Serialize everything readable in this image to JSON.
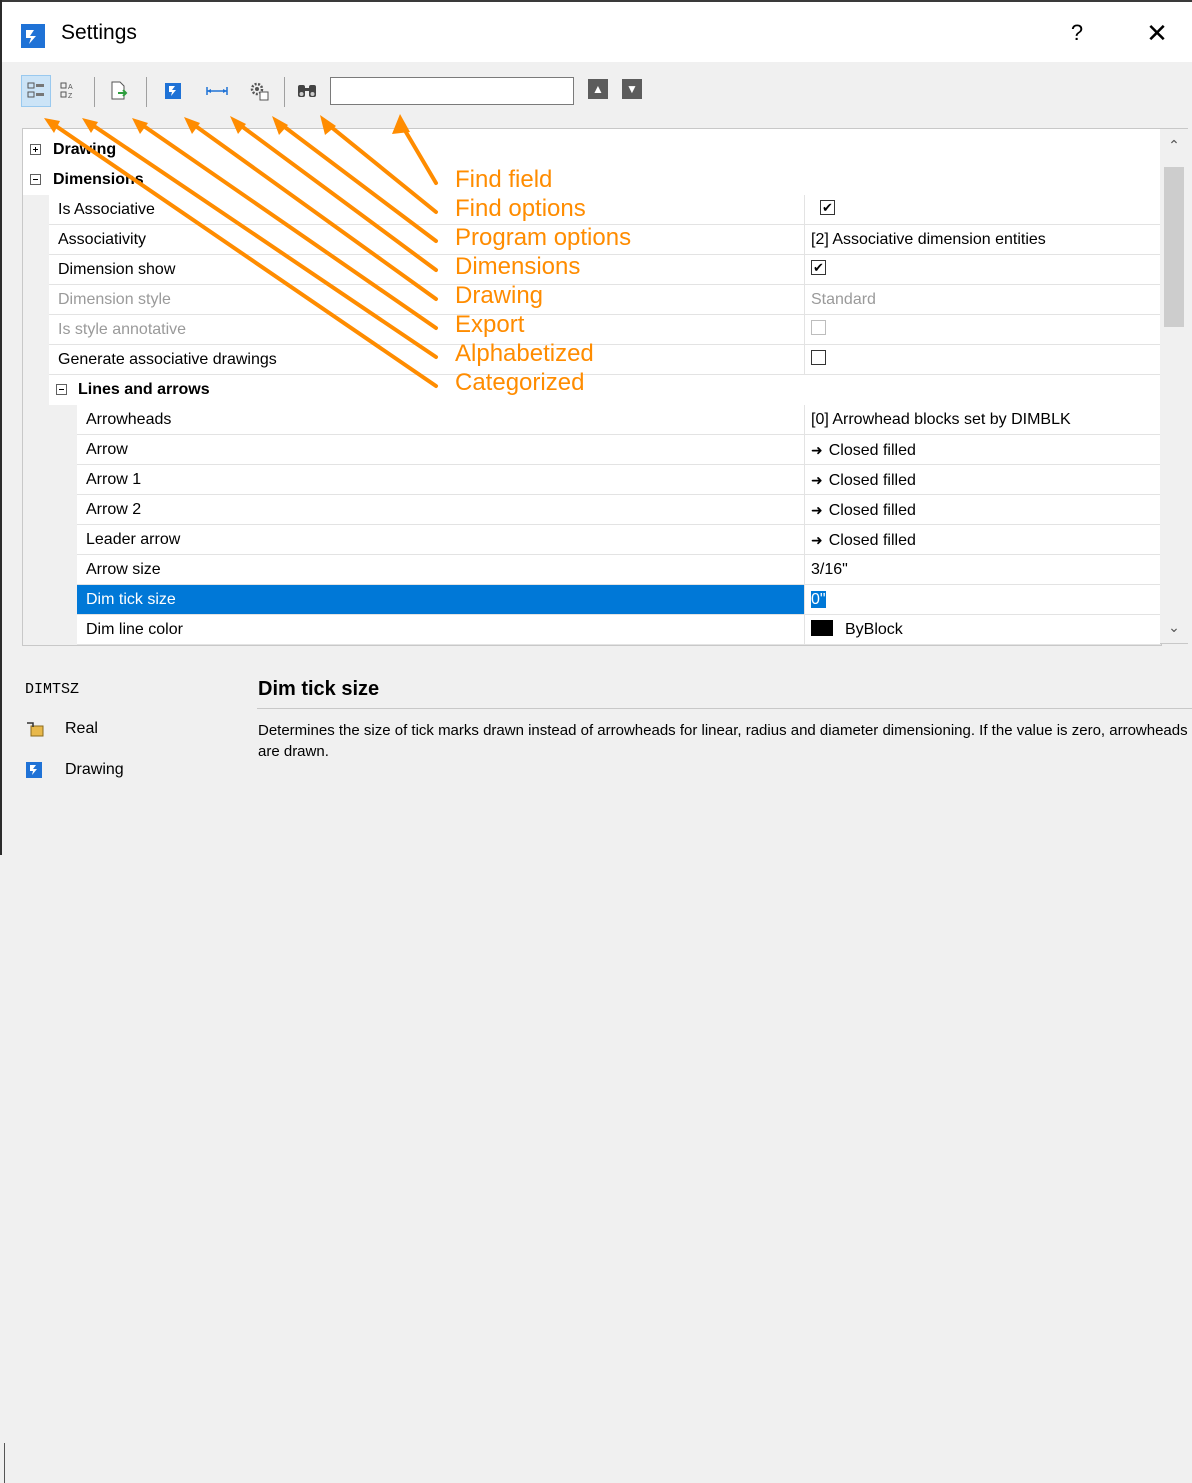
{
  "window": {
    "title": "Settings",
    "help_label": "?",
    "close_label": "✕"
  },
  "toolbar": {
    "find_value": "",
    "buttons": [
      "Categorized",
      "Alphabetized",
      "Export",
      "Drawing",
      "Dimensions",
      "Program options",
      "Find options"
    ],
    "nav_up": "▲",
    "nav_down": "▼"
  },
  "grid": {
    "rows": [
      {
        "name": "Drawing",
        "value": ""
      },
      {
        "name": "Dimensions",
        "value": ""
      },
      {
        "name": "Is Associative",
        "value": "",
        "checked": true
      },
      {
        "name": "Associativity",
        "value": "[2] Associative dimension entities"
      },
      {
        "name": "Dimension show",
        "value": "",
        "checked": true
      },
      {
        "name": "Dimension style",
        "value": "Standard",
        "disabled": true
      },
      {
        "name": "Is style annotative",
        "value": "",
        "checked": false,
        "disabled": true
      },
      {
        "name": "Generate associative drawings",
        "value": "",
        "checked": false
      },
      {
        "name": "Lines and arrows",
        "value": ""
      },
      {
        "name": "Arrowheads",
        "value": "[0] Arrowhead blocks set by DIMBLK"
      },
      {
        "name": "Arrow",
        "value": "Closed filled"
      },
      {
        "name": "Arrow 1",
        "value": "Closed filled"
      },
      {
        "name": "Arrow 2",
        "value": "Closed filled"
      },
      {
        "name": "Leader arrow",
        "value": "Closed filled"
      },
      {
        "name": "Arrow size",
        "value": "3/16\""
      },
      {
        "name": "Dim tick size",
        "value": "0\"",
        "selected": true
      },
      {
        "name": "Dim line color",
        "value": "ByBlock"
      }
    ]
  },
  "annotations": {
    "labels": [
      "Find field",
      "Find options",
      "Program options",
      "Dimensions",
      "Drawing",
      "Export",
      "Alphabetized",
      "Categorized"
    ],
    "color": "#ff8c00"
  },
  "description": {
    "sysvar": "DIMTSZ",
    "type": "Real",
    "source": "Drawing",
    "title": "Dim tick size",
    "text": "Determines the size of tick marks drawn instead of arrowheads for linear, radius and diameter dimensioning. If the value is zero, arrowheads are drawn."
  },
  "colors": {
    "selection": "#0078d7",
    "app_logo": "#1f72d6",
    "annotation": "#ff8c00"
  }
}
